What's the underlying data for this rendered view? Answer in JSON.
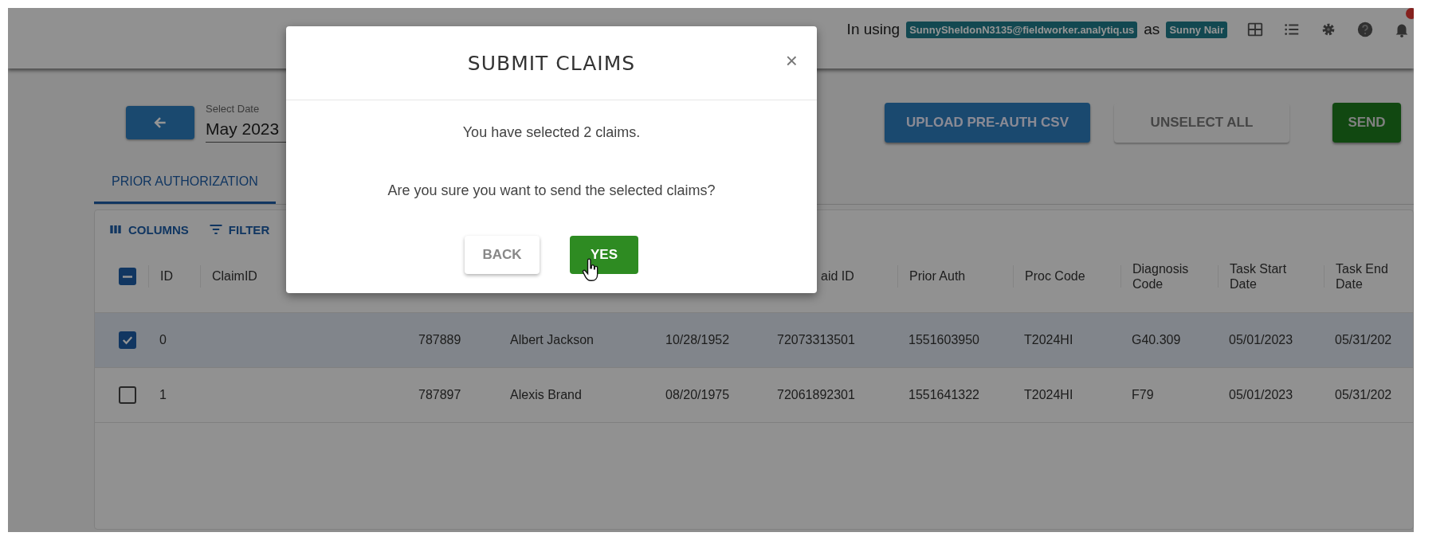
{
  "top_bar": {
    "prefix": "In using",
    "account": "SunnySheldonN3135@fieldworker.analytiq.us",
    "joiner": "as",
    "user": "Sunny Nair",
    "icons": [
      {
        "kind": "grid"
      },
      {
        "kind": "list"
      },
      {
        "kind": "settings"
      },
      {
        "kind": "help"
      },
      {
        "kind": "bell",
        "badge": true
      }
    ]
  },
  "date_picker": {
    "label": "Select Date",
    "value": "May 2023"
  },
  "actions": [
    {
      "label": "UPLOAD PRE-AUTH CSV",
      "kind": "primary"
    },
    {
      "label": "UNSELECT ALL",
      "kind": "text"
    },
    {
      "label": "SEND",
      "kind": "success"
    }
  ],
  "tabs": [
    {
      "label": "PRIOR AUTHORIZATION",
      "selected": true
    }
  ],
  "toolbar": [
    {
      "label": "COLUMNS",
      "kind": "columns"
    },
    {
      "label": "FILTER",
      "kind": "filter"
    }
  ],
  "table": {
    "select_all_partial": true,
    "columns": [
      {
        "header": "ID"
      },
      {
        "header": "ClaimID"
      },
      {},
      {},
      {},
      {
        "header": "aid ID"
      },
      {
        "header": "Prior Auth"
      },
      {
        "header": "Proc Code"
      },
      {
        "header": "Diagnosis Code"
      },
      {
        "header": "Task Start Date"
      },
      {
        "header": "Task End Date"
      }
    ],
    "rows": [
      {
        "selected": true,
        "checked": true,
        "cells": [
          "0",
          null,
          "787889",
          "Albert Jackson",
          "10/28/1952",
          "72073313501",
          "1551603950",
          "T2024HI",
          "G40.309",
          "05/01/2023",
          "05/31/202"
        ]
      },
      {
        "selected": false,
        "checked": false,
        "cells": [
          "1",
          null,
          "787897",
          "Alexis Brand",
          "08/20/1975",
          "72061892301",
          "1551641322",
          "T2024HI",
          "F79",
          "05/01/2023",
          "05/31/202"
        ]
      }
    ]
  },
  "dialog": {
    "title": "SUBMIT CLAIMS",
    "close": "×",
    "messages": [
      "You have selected 2 claims.",
      "Are you sure you want to send the selected claims?"
    ],
    "buttons": [
      {
        "label": "BACK",
        "kind": "outlined"
      },
      {
        "label": "YES",
        "kind": "success"
      }
    ]
  }
}
